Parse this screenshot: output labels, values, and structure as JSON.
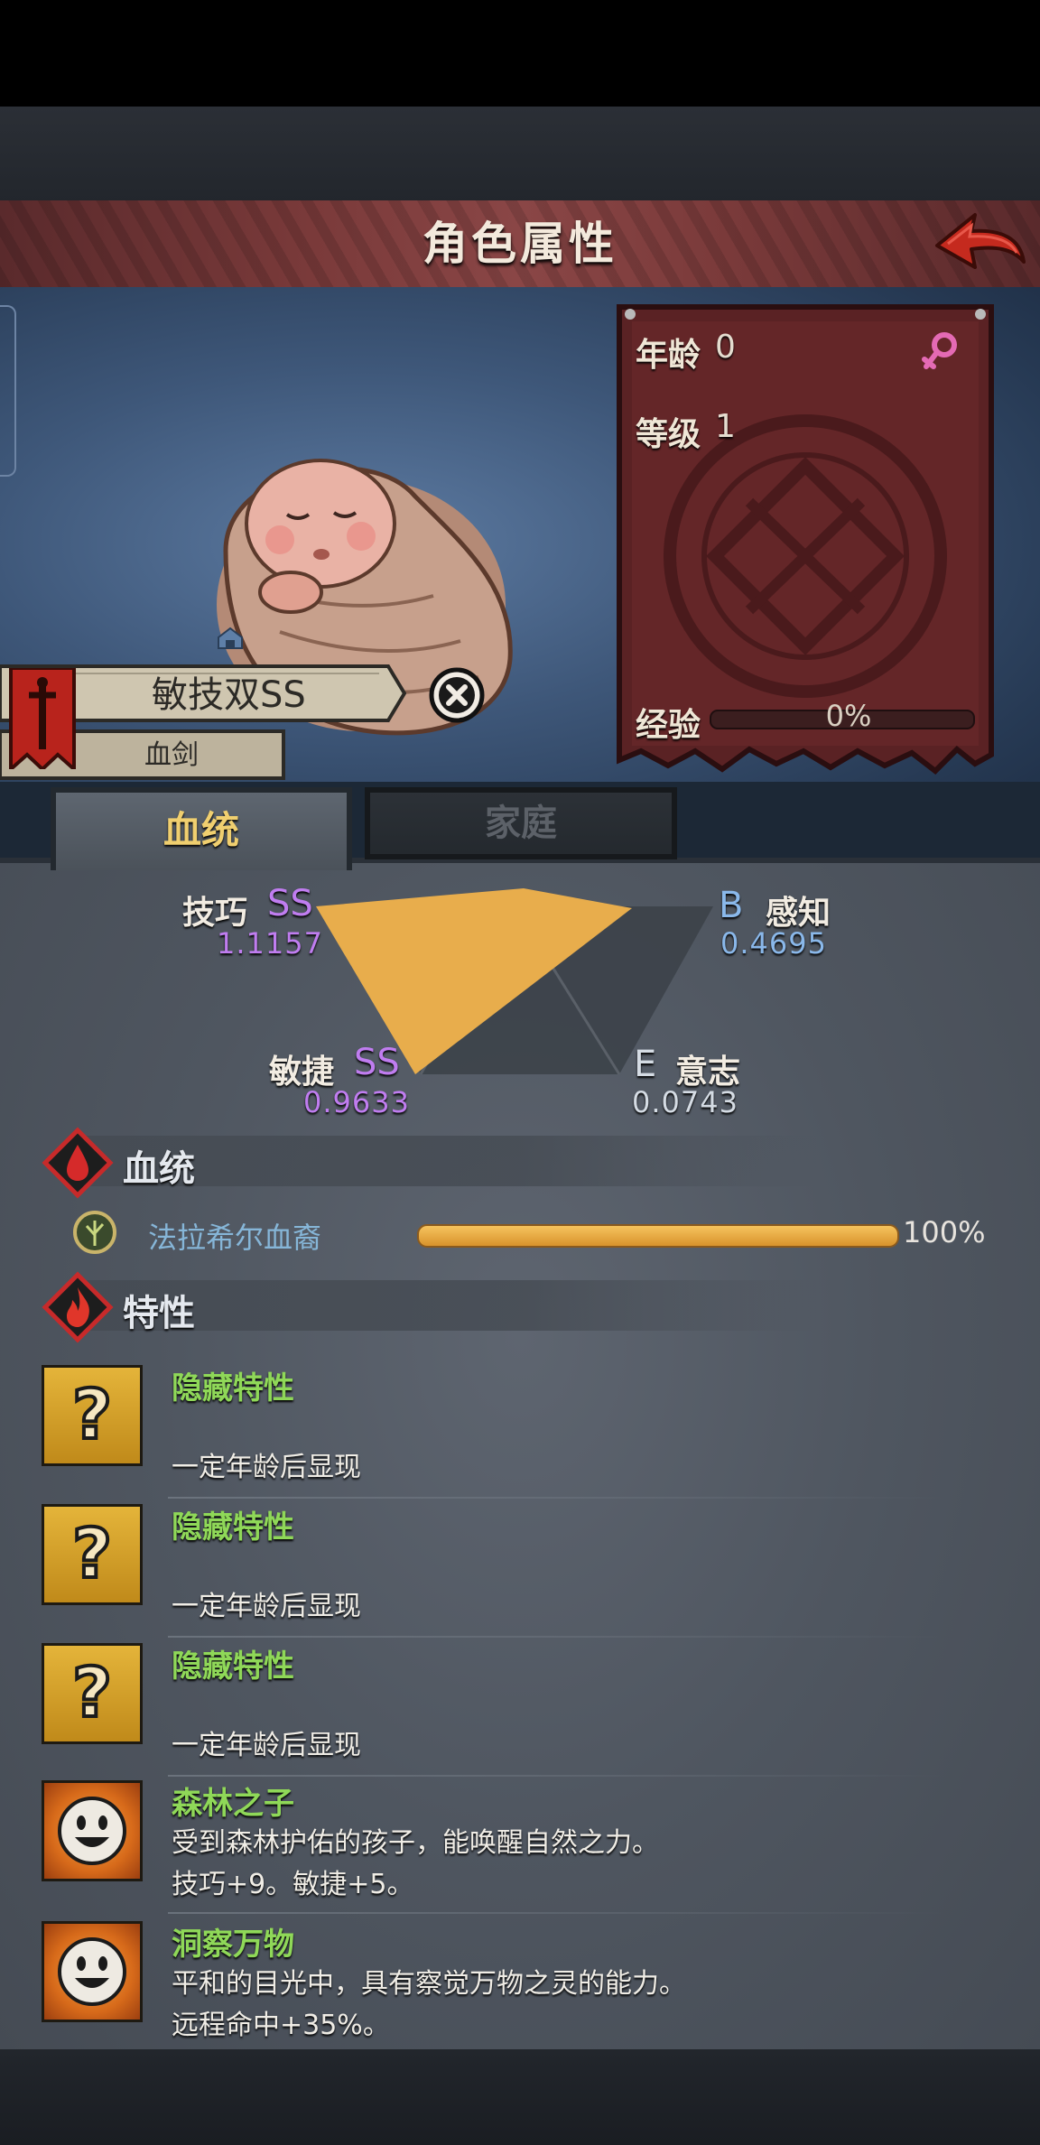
{
  "header": {
    "title": "角色属性"
  },
  "character": {
    "name": "敏技双SS",
    "class": "血剑",
    "age_label": "年龄",
    "age": "0",
    "level_label": "等级",
    "level": "1",
    "exp_label": "经验",
    "exp_pct": "0%",
    "exp_progress": 0
  },
  "tabs": {
    "bloodline": "血统",
    "family": "家庭"
  },
  "stats": {
    "dexterity": {
      "label": "技巧",
      "grade": "SS",
      "value": "1.1157"
    },
    "perception": {
      "label": "感知",
      "grade": "B",
      "value": "0.4695"
    },
    "agility": {
      "label": "敏捷",
      "grade": "SS",
      "value": "0.9633"
    },
    "will": {
      "label": "意志",
      "grade": "E",
      "value": "0.0743"
    }
  },
  "bloodline_section": {
    "title": "血统",
    "name": "法拉希尔血裔",
    "pct": "100%",
    "progress": 100
  },
  "traits_section": {
    "title": "特性"
  },
  "traits": [
    {
      "icon": "question-icon",
      "name": "隐藏特性",
      "line1": "",
      "line2": "一定年龄后显现"
    },
    {
      "icon": "question-icon",
      "name": "隐藏特性",
      "line1": "",
      "line2": "一定年龄后显现"
    },
    {
      "icon": "question-icon",
      "name": "隐藏特性",
      "line1": "",
      "line2": "一定年龄后显现"
    },
    {
      "icon": "smiley-face-icon",
      "name": "森林之子",
      "line1": "受到森林护佑的孩子，能唤醒自然之力。",
      "line2": "技巧+9。敏捷+5。"
    },
    {
      "icon": "smiley-face-icon",
      "name": "洞察万物",
      "line1": "平和的目光中，具有察觉万物之灵的能力。",
      "line2": "远程命中+35%。"
    }
  ],
  "colors": {
    "grade_ss": "#c07df0",
    "grade_b": "#8ab8ea",
    "grade_e": "#d5dce4",
    "trait_name": "#8fd858",
    "radar_fill": "#e8ad4c"
  }
}
